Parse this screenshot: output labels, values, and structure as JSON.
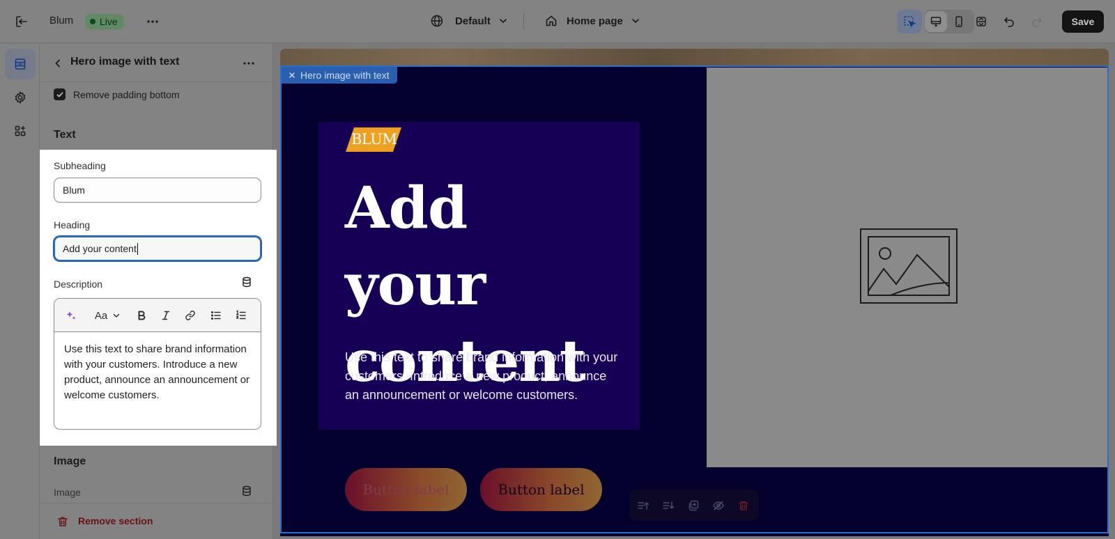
{
  "topbar": {
    "store_name": "Blum",
    "status_badge": "Live",
    "theme_select": "Default",
    "page_select": "Home page",
    "save_label": "Save"
  },
  "panel": {
    "title": "Hero image with text",
    "checkbox_label": "Remove padding bottom",
    "checkbox_checked": true,
    "section_text": "Text",
    "subheading_label": "Subheading",
    "subheading_value": "Blum",
    "heading_label": "Heading",
    "heading_value": "Add your content",
    "description_label": "Description",
    "font_tool_label": "Aa",
    "description_value": "Use this text to share brand information with your customers. Introduce a new product, announce an announcement or welcome customers.",
    "section_image": "Image",
    "image_label": "Image",
    "remove_label": "Remove section"
  },
  "preview": {
    "selected_tag": "Hero image with text",
    "logo_text": "BLUM",
    "heading": "Add your content",
    "description": "Use this text to share brand information with your customers. Introduce a new product, announce an announcement or welcome customers.",
    "button1": "Button label",
    "button2": "Button label"
  },
  "colors": {
    "accent_blue": "#2c6ecb",
    "hero_bg": "#03002d",
    "hero_box": "#150056",
    "logo_bg": "#f0a020",
    "danger": "#6a1010"
  }
}
